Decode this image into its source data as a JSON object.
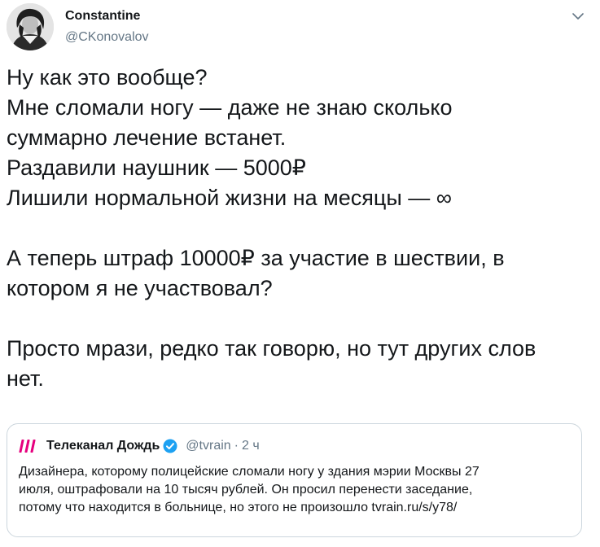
{
  "author": {
    "name": "Constantine",
    "handle": "@CKonovalov",
    "avatar_icon": "user-avatar"
  },
  "menu_icon": "chevron-down-icon",
  "tweet": {
    "lines": [
      "Ну как это вообще?",
      "Мне сломали ногу — даже не знаю сколько",
      "суммарно лечение встанет.",
      "Раздавили наушник — 5000₽",
      "Лишили нормальной жизни на месяцы — ∞",
      "",
      "А теперь штраф 10000₽ за участие в шествии, в",
      "котором я не участвовал?",
      "",
      "Просто мрази, редко так говорю, но тут других слов",
      "нет."
    ]
  },
  "quoted": {
    "name": "Телеканал Дождь",
    "handle": "@tvrain",
    "separator": "·",
    "time": "2 ч",
    "logo_icon": "tvrain-logo",
    "verified_icon": "verified-badge-icon",
    "text_lines": [
      "Дизайнера, которому полицейские сломали ногу у здания мэрии Москвы 27",
      "июля, оштрафовали на 10 тысяч рублей. Он просил перенести заседание,",
      "потому что находится в больнице, но этого не произошло tvrain.ru/s/y78/"
    ]
  },
  "colors": {
    "text": "#14171a",
    "secondary": "#657786",
    "border": "#ccd6dd",
    "verified": "#1da1f2",
    "tvrain_pink": "#e6007e"
  }
}
